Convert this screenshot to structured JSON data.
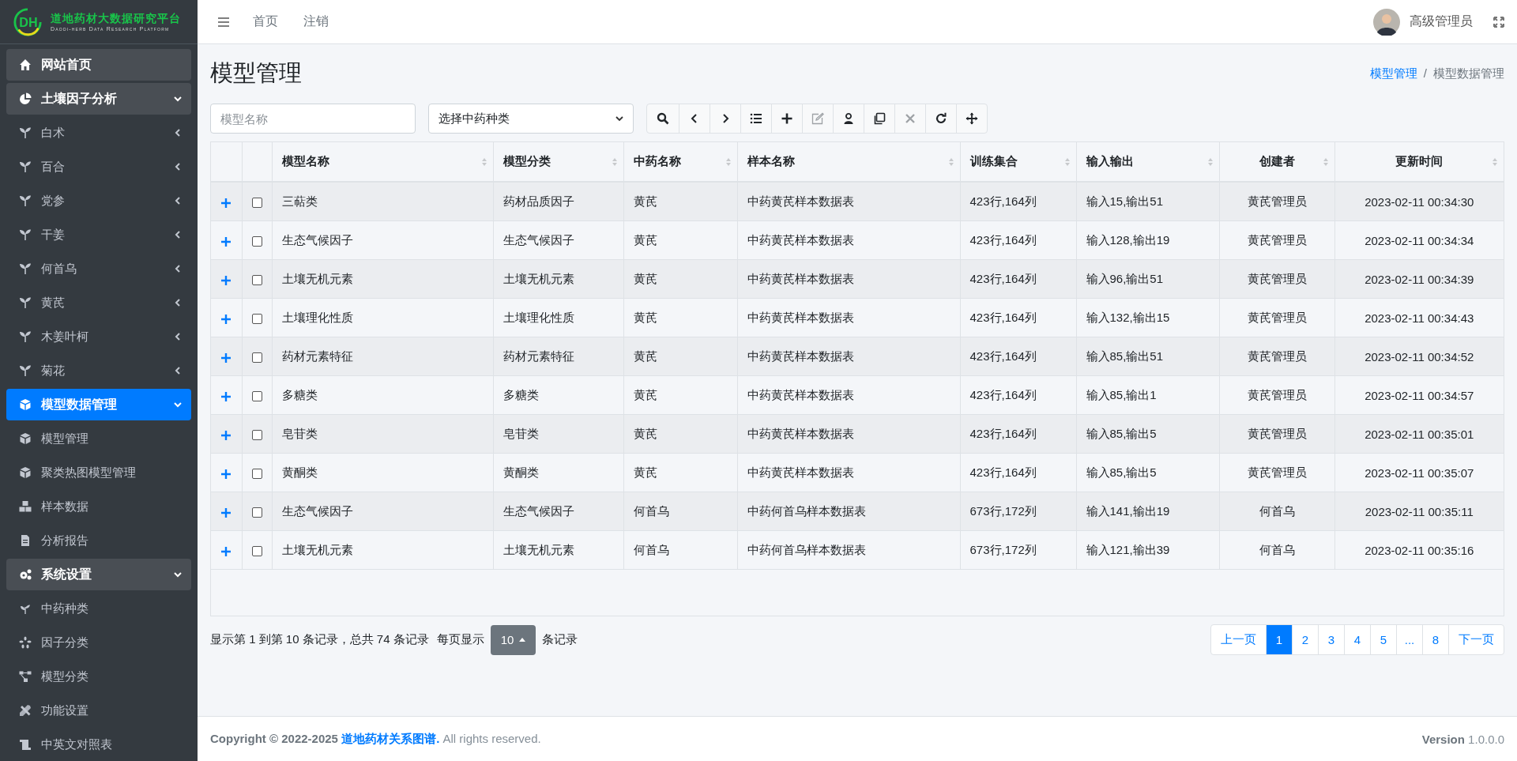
{
  "logo": {
    "mark": "DH",
    "title": "道地药材大数据研究平台",
    "subtitle": "Daodi-herb Data Research Platform"
  },
  "sidebar": {
    "items": [
      {
        "label": "网站首页",
        "kind": "home",
        "selected": false
      },
      {
        "label": "土壤因子分析",
        "kind": "chart",
        "selected": false,
        "expanded": true,
        "children": [
          {
            "label": "白术",
            "kind": "sprout",
            "expanded": false
          },
          {
            "label": "百合",
            "kind": "sprout",
            "expanded": false
          },
          {
            "label": "党参",
            "kind": "sprout",
            "expanded": false
          },
          {
            "label": "干姜",
            "kind": "sprout",
            "expanded": false
          },
          {
            "label": "何首乌",
            "kind": "sprout",
            "expanded": false
          },
          {
            "label": "黄芪",
            "kind": "sprout",
            "expanded": false
          },
          {
            "label": "木姜叶柯",
            "kind": "sprout",
            "expanded": false
          },
          {
            "label": "菊花",
            "kind": "sprout",
            "expanded": false
          }
        ]
      },
      {
        "label": "模型数据管理",
        "kind": "cube",
        "selected": true,
        "expanded": true,
        "children": [
          {
            "label": "模型管理",
            "kind": "cube"
          },
          {
            "label": "聚类热图模型管理",
            "kind": "cube"
          },
          {
            "label": "样本数据",
            "kind": "cubes"
          },
          {
            "label": "分析报告",
            "kind": "file"
          }
        ]
      },
      {
        "label": "系统设置",
        "kind": "gears",
        "selected": false,
        "expanded": true,
        "children": [
          {
            "label": "中药种类",
            "kind": "seedling"
          },
          {
            "label": "因子分类",
            "kind": "asterisk"
          },
          {
            "label": "模型分类",
            "kind": "sitemap"
          },
          {
            "label": "功能设置",
            "kind": "tools"
          },
          {
            "label": "中英文对照表",
            "kind": "scroll"
          }
        ]
      }
    ]
  },
  "topbar": {
    "links": [
      "首页",
      "注销"
    ],
    "user": "高级管理员"
  },
  "page": {
    "title": "模型管理",
    "breadcrumb": [
      "模型管理",
      "模型数据管理"
    ],
    "breadcrumb_separator": "/"
  },
  "filters": {
    "name": {
      "placeholder": "模型名称"
    },
    "species": {
      "value": "选择中药种类"
    }
  },
  "toolbar": [
    {
      "kind": "search",
      "disabled": false
    },
    {
      "kind": "prev",
      "disabled": false
    },
    {
      "kind": "next",
      "disabled": false
    },
    {
      "kind": "list",
      "disabled": false
    },
    {
      "kind": "add",
      "disabled": false
    },
    {
      "kind": "edit",
      "disabled": true
    },
    {
      "kind": "user",
      "disabled": false
    },
    {
      "kind": "copy",
      "disabled": false
    },
    {
      "kind": "delete",
      "disabled": true
    },
    {
      "kind": "refresh",
      "disabled": false
    },
    {
      "kind": "move",
      "disabled": false
    }
  ],
  "table": {
    "columns": [
      "模型名称",
      "模型分类",
      "中药名称",
      "样本名称",
      "训练集合",
      "输入输出",
      "创建者",
      "更新时间"
    ],
    "rows": [
      {
        "checked": false,
        "cells": [
          "三萜类",
          "药材品质因子",
          "黄芪",
          "中药黄芪样本数据表",
          "423行,164列",
          "输入15,输出51",
          "黄芪管理员",
          "2023-02-11 00:34:30"
        ]
      },
      {
        "checked": false,
        "cells": [
          "生态气候因子",
          "生态气候因子",
          "黄芪",
          "中药黄芪样本数据表",
          "423行,164列",
          "输入128,输出19",
          "黄芪管理员",
          "2023-02-11 00:34:34"
        ]
      },
      {
        "checked": false,
        "cells": [
          "土壤无机元素",
          "土壤无机元素",
          "黄芪",
          "中药黄芪样本数据表",
          "423行,164列",
          "输入96,输出51",
          "黄芪管理员",
          "2023-02-11 00:34:39"
        ]
      },
      {
        "checked": false,
        "cells": [
          "土壤理化性质",
          "土壤理化性质",
          "黄芪",
          "中药黄芪样本数据表",
          "423行,164列",
          "输入132,输出15",
          "黄芪管理员",
          "2023-02-11 00:34:43"
        ]
      },
      {
        "checked": false,
        "cells": [
          "药材元素特征",
          "药材元素特征",
          "黄芪",
          "中药黄芪样本数据表",
          "423行,164列",
          "输入85,输出51",
          "黄芪管理员",
          "2023-02-11 00:34:52"
        ]
      },
      {
        "checked": false,
        "cells": [
          "多糖类",
          "多糖类",
          "黄芪",
          "中药黄芪样本数据表",
          "423行,164列",
          "输入85,输出1",
          "黄芪管理员",
          "2023-02-11 00:34:57"
        ]
      },
      {
        "checked": false,
        "cells": [
          "皂苷类",
          "皂苷类",
          "黄芪",
          "中药黄芪样本数据表",
          "423行,164列",
          "输入85,输出5",
          "黄芪管理员",
          "2023-02-11 00:35:01"
        ]
      },
      {
        "checked": false,
        "cells": [
          "黄酮类",
          "黄酮类",
          "黄芪",
          "中药黄芪样本数据表",
          "423行,164列",
          "输入85,输出5",
          "黄芪管理员",
          "2023-02-11 00:35:07"
        ]
      },
      {
        "checked": false,
        "cells": [
          "生态气候因子",
          "生态气候因子",
          "何首乌",
          "中药何首乌样本数据表",
          "673行,172列",
          "输入141,输出19",
          "何首乌",
          "2023-02-11 00:35:11"
        ]
      },
      {
        "checked": false,
        "cells": [
          "土壤无机元素",
          "土壤无机元素",
          "何首乌",
          "中药何首乌样本数据表",
          "673行,172列",
          "输入121,输出39",
          "何首乌",
          "2023-02-11 00:35:16"
        ]
      }
    ]
  },
  "pagination": {
    "info": "显示第 1 到第 10 条记录，总共 74 条记录",
    "per_page_label": "每页显示",
    "page_size": "10",
    "per_page_suffix": "条记录",
    "prev": "上一页",
    "next": "下一页",
    "pages": [
      {
        "label": "1",
        "selected": true
      },
      {
        "label": "2",
        "selected": false
      },
      {
        "label": "3",
        "selected": false
      },
      {
        "label": "4",
        "selected": false
      },
      {
        "label": "5",
        "selected": false
      },
      {
        "label": "...",
        "selected": false
      },
      {
        "label": "8",
        "selected": false
      }
    ]
  },
  "footer": {
    "copyright": "Copyright © 2022-2025",
    "link": "道地药材关系图谱.",
    "rights": "All rights reserved.",
    "version": "**Version** 1.0.0.0"
  }
}
